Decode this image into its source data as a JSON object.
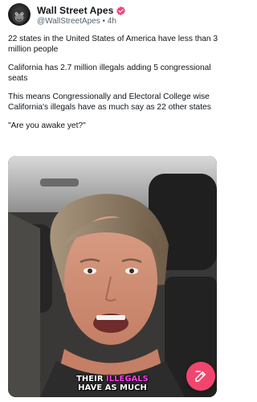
{
  "author": {
    "display_name": "Wall Street Apes",
    "handle": "@WallStreetApes",
    "separator": "•",
    "time": "4h",
    "avatar_icon": "ape-avatar",
    "verified_color": "#f2457b"
  },
  "post": {
    "paragraphs": [
      "22 states in the United States of America have less than 3 million people",
      "California has 2.7 million illegals adding 5 congressional seats",
      "This means Congressionally and Electoral College wise California's illegals have as much say as 22 other states",
      "\"Are you awake yet?\""
    ]
  },
  "media": {
    "caption_line1_a": "THEIR ",
    "caption_line1_b": "ILLEGALS",
    "caption_line2": "HAVE AS MUCH",
    "highlight_color": "#ff3cf0"
  },
  "fab": {
    "icon": "compose-icon",
    "color": "#f0466d"
  }
}
